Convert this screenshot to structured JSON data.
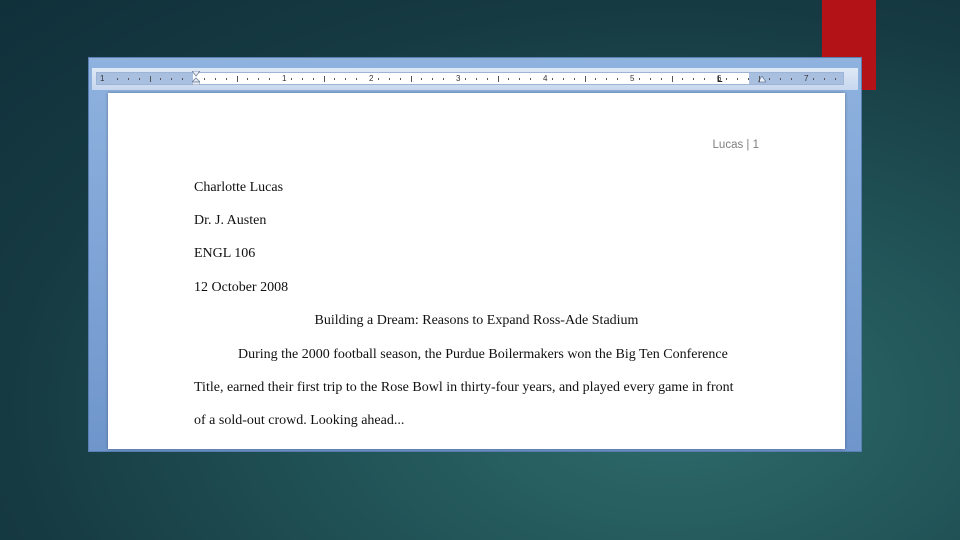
{
  "ruler": {
    "numbers": [
      "1",
      "1",
      "2",
      "3",
      "4",
      "5",
      "6",
      "7"
    ],
    "tab_marker": "L"
  },
  "document": {
    "header": "Lucas | 1",
    "heading_lines": [
      "Charlotte Lucas",
      "Dr. J. Austen",
      "ENGL 106",
      "12 October 2008"
    ],
    "title": "Building a Dream: Reasons to Expand Ross-Ade Stadium",
    "body_lines": [
      "During the 2000 football season, the Purdue Boilermakers  won the Big Ten Conference",
      "Title, earned their first trip to the Rose Bowl in thirty-four years, and played every game in front",
      "of a sold-out crowd.  Looking ahead..."
    ]
  },
  "colors": {
    "accent_red": "#b31217",
    "window_blue": "#7fa3d6",
    "header_gray": "#7f7f7f"
  }
}
